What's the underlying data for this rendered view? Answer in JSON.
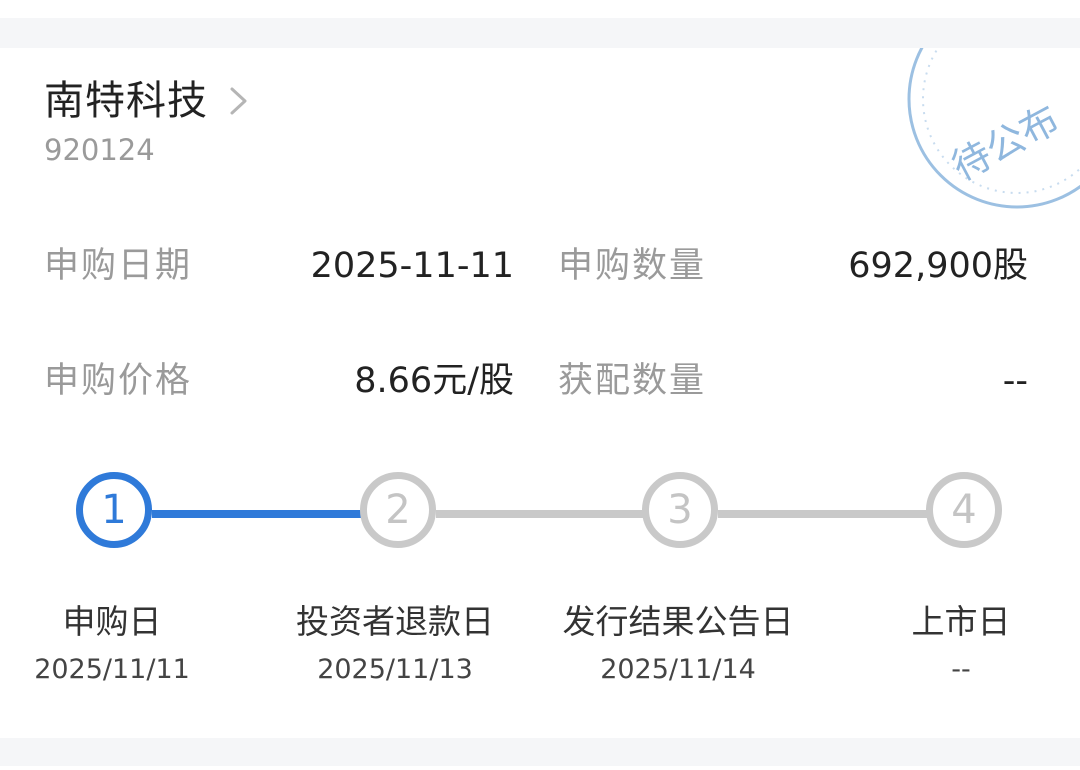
{
  "stock": {
    "name": "南特科技",
    "code": "920124"
  },
  "stamp": {
    "text": "待公布"
  },
  "info": {
    "subscribe_date_label": "申购日期",
    "subscribe_date_value": "2025-11-11",
    "subscribe_qty_label": "申购数量",
    "subscribe_qty_value": "692,900股",
    "subscribe_price_label": "申购价格",
    "subscribe_price_value": "8.66元/股",
    "allotted_qty_label": "获配数量",
    "allotted_qty_value": "--"
  },
  "steps": [
    {
      "number": "1",
      "label": "申购日",
      "date": "2025/11/11",
      "state": "active"
    },
    {
      "number": "2",
      "label": "投资者退款日",
      "date": "2025/11/13",
      "state": "inactive"
    },
    {
      "number": "3",
      "label": "发行结果公告日",
      "date": "2025/11/14",
      "state": "inactive"
    },
    {
      "number": "4",
      "label": "上市日",
      "date": "--",
      "state": "inactive"
    }
  ],
  "colors": {
    "accent": "#2f7ad9",
    "inactive": "#c9c9c9",
    "stamp": "#8fb7de"
  },
  "icons": {
    "header_arrow": "chevron-right-icon"
  }
}
